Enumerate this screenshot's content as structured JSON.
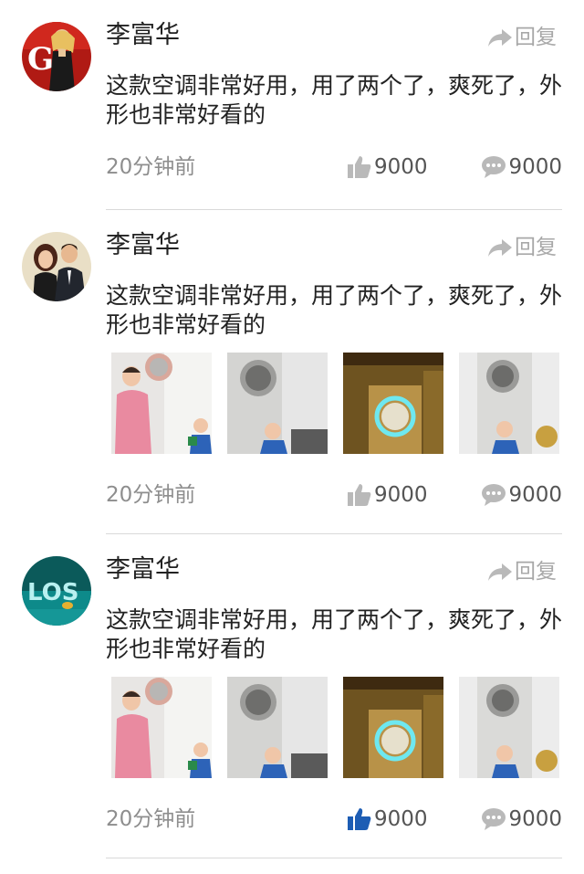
{
  "comments": [
    {
      "author": "李富华",
      "reply_label": "回复",
      "text": "这款空调非常好用，用了两个了，爽死了，外形也非常好看的",
      "time": "20分钟前",
      "likes": "9000",
      "comments": "9000",
      "liked": false,
      "avatar": "avatar-woman-red-backdrop",
      "photos": []
    },
    {
      "author": "李富华",
      "reply_label": "回复",
      "text": "这款空调非常好用，用了两个了，爽死了，外形也非常好看的",
      "time": "20分钟前",
      "likes": "9000",
      "comments": "9000",
      "liked": false,
      "avatar": "avatar-couple",
      "photos": [
        "photo-woman-child-aircon",
        "photo-child-aircon",
        "photo-gold-aircon",
        "photo-child-aircon-2"
      ]
    },
    {
      "author": "李富华",
      "reply_label": "回复",
      "text": "这款空调非常好用，用了两个了，爽死了，外形也非常好看的",
      "time": "20分钟前",
      "likes": "9000",
      "comments": "9000",
      "liked": true,
      "avatar": "avatar-los-logo",
      "photos": [
        "photo-woman-child-aircon",
        "photo-child-aircon",
        "photo-gold-aircon",
        "photo-child-aircon-2"
      ]
    }
  ],
  "colors": {
    "liked": "#1d5db4",
    "icon_grey": "#b9b9b9",
    "divider": "#d9d9d9"
  }
}
